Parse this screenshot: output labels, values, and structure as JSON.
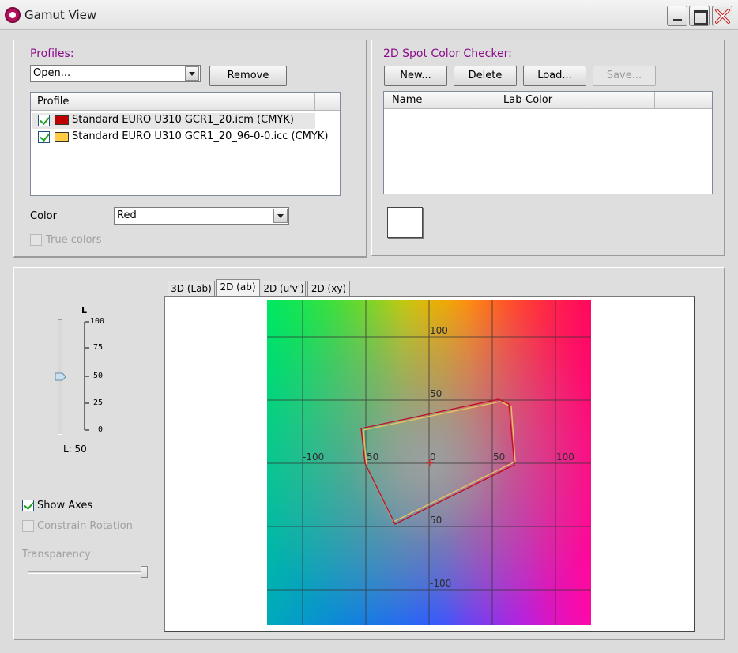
{
  "window": {
    "title": "Gamut View"
  },
  "profiles": {
    "heading": "Profiles:",
    "open_combo": "Open...",
    "remove_button": "Remove",
    "list_header": "Profile",
    "items": [
      {
        "label": "Standard EURO U310 GCR1_20.icm (CMYK)",
        "color": "#c00000",
        "checked": true
      },
      {
        "label": "Standard EURO U310 GCR1_20_96-0-0.icc (CMYK)",
        "color": "#ffcc44",
        "checked": true
      }
    ],
    "color_label": "Color",
    "color_value": "Red",
    "true_colors_label": "True colors"
  },
  "spot_checker": {
    "heading": "2D Spot Color Checker:",
    "new_button": "New...",
    "delete_button": "Delete",
    "load_button": "Load...",
    "save_button": "Save...",
    "col_name": "Name",
    "col_lab": "Lab-Color"
  },
  "lightness": {
    "axis_letter": "L",
    "ticks": [
      "100",
      "75",
      "50",
      "25",
      "0"
    ],
    "value_text": "L: 50",
    "value": 50
  },
  "options": {
    "show_axes": "Show Axes",
    "constrain_rotation": "Constrain Rotation",
    "transparency": "Transparency"
  },
  "tabs": [
    "3D (Lab)",
    "2D (ab)",
    "2D (u'v')",
    "2D (xy)"
  ],
  "active_tab": 1,
  "plot": {
    "axis_labels": {
      "a_neg100": "-100",
      "a_neg50": "50",
      "a_zero": "0",
      "a_pos50": "50",
      "a_pos100": "100",
      "b_pos100": "100",
      "b_pos50": "50",
      "b_neg50": "50",
      "b_neg100": "-100"
    },
    "gamut_red_color": "#c0102a",
    "gamut_yellow_color": "#e8c060"
  }
}
